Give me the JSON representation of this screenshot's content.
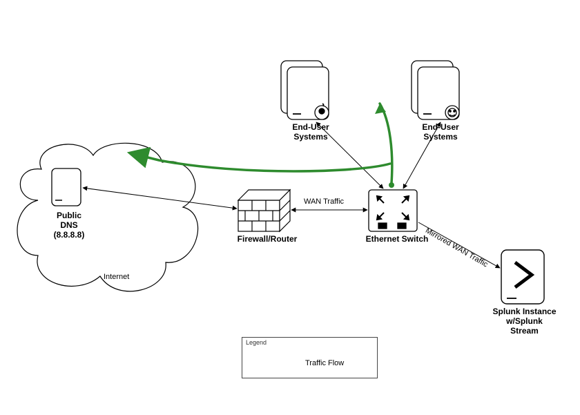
{
  "nodes": {
    "public_dns": {
      "label": "Public\nDNS\n(8.8.8.8)"
    },
    "internet": {
      "label": "Internet"
    },
    "firewall": {
      "label": "Firewall/Router"
    },
    "switch": {
      "label": "Ethernet Switch"
    },
    "enduser1": {
      "label": "End-User\nSystems"
    },
    "enduser2": {
      "label": "End-User\nSystems"
    },
    "splunk": {
      "label": "Splunk Instance\nw/Splunk\nStream"
    }
  },
  "edges": {
    "wan": {
      "label": "WAN Traffic"
    },
    "mirrored": {
      "label": "Mirrored WAN Traffic"
    }
  },
  "legend": {
    "title": "Legend",
    "flow": "Traffic Flow"
  },
  "colors": {
    "flow_arrow": "#2e8b2e",
    "line": "#000000"
  }
}
